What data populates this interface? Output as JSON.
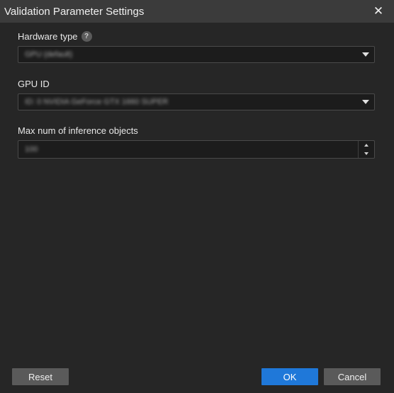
{
  "window": {
    "title": "Validation Parameter Settings",
    "close_glyph": "✕"
  },
  "fields": {
    "hardware_type": {
      "label": "Hardware type",
      "help_glyph": "?",
      "value": "GPU (default)"
    },
    "gpu_id": {
      "label": "GPU ID",
      "value": "ID: 0  NVIDIA GeForce GTX 1660 SUPER"
    },
    "max_inference": {
      "label": "Max num of inference objects",
      "value": "100"
    }
  },
  "buttons": {
    "reset": "Reset",
    "ok": "OK",
    "cancel": "Cancel"
  },
  "colors": {
    "accent": "#1f78d9",
    "background": "#262626",
    "titlebar": "#3b3b3b"
  }
}
